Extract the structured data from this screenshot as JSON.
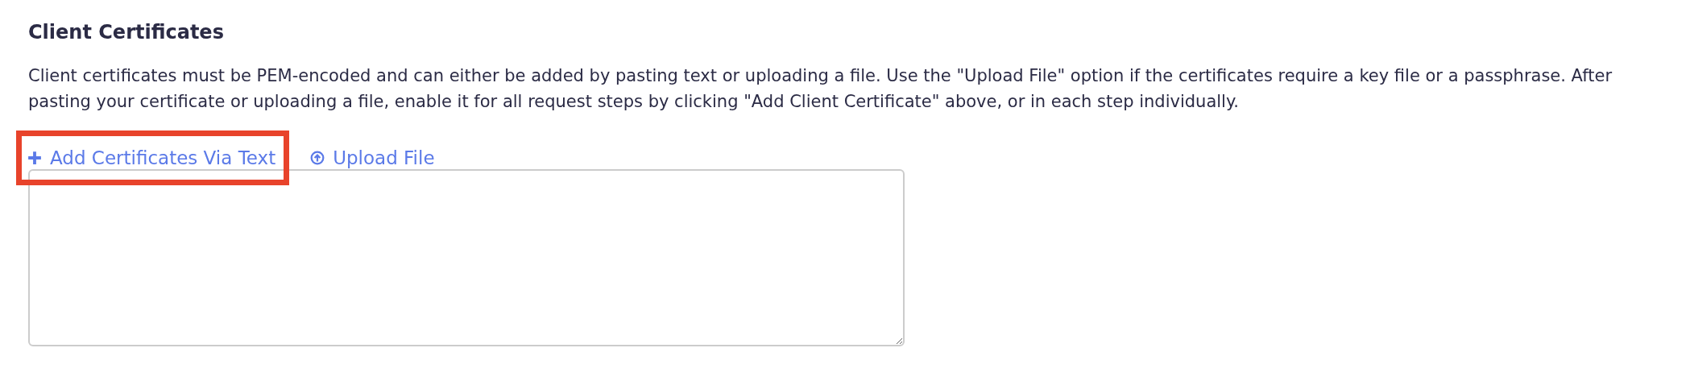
{
  "section": {
    "title": "Client Certificates",
    "description": "Client certificates must be PEM-encoded and can either be added by pasting text or uploading a file. Use the \"Upload File\" option if the certificates require a key file or a passphrase. After pasting your certificate or uploading a file, enable it for all request steps by clicking \"Add Client Certificate\" above, or in each step individually."
  },
  "options": [
    {
      "kind": "plus",
      "label": "Add Certificates Via Text",
      "highlighted": true
    },
    {
      "kind": "upload",
      "label": "Upload File",
      "highlighted": false
    }
  ]
}
